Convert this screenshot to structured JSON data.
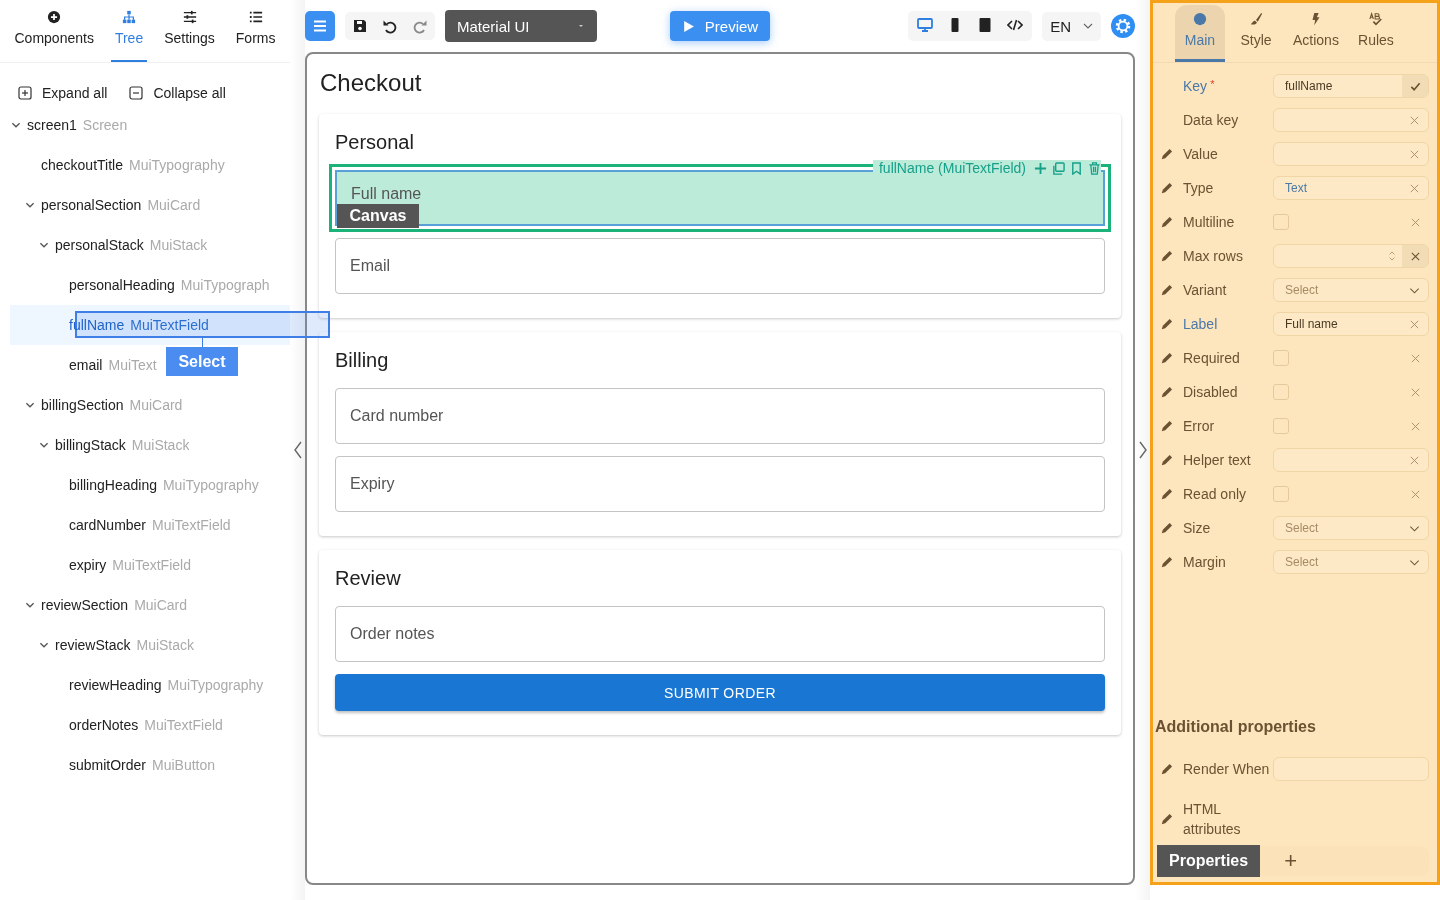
{
  "left_tabs": [
    {
      "label": "Components",
      "selected": false
    },
    {
      "label": "Tree",
      "selected": true
    },
    {
      "label": "Settings",
      "selected": false
    },
    {
      "label": "Forms",
      "selected": false
    }
  ],
  "tree_actions": [
    "Expand all",
    "Collapse all"
  ],
  "tree": [
    {
      "name": "screen1",
      "type": "Screen",
      "expanded": true,
      "selected": false,
      "children": [
        {
          "name": "checkoutTitle",
          "type": "MuiTypography",
          "selected": false
        },
        {
          "name": "personalSection",
          "type": "MuiCard",
          "expanded": true,
          "selected": false,
          "children": [
            {
              "name": "personalStack",
              "type": "MuiStack",
              "expanded": true,
              "selected": false,
              "children": [
                {
                  "name": "personalHeading",
                  "type": "MuiTypograph",
                  "selected": false
                },
                {
                  "name": "fullName",
                  "type": "MuiTextField",
                  "selected": true
                },
                {
                  "name": "email",
                  "type": "MuiText",
                  "selected": false
                }
              ]
            }
          ]
        },
        {
          "name": "billingSection",
          "type": "MuiCard",
          "expanded": true,
          "selected": false,
          "children": [
            {
              "name": "billingStack",
              "type": "MuiStack",
              "expanded": true,
              "selected": false,
              "children": [
                {
                  "name": "billingHeading",
                  "type": "MuiTypography",
                  "selected": false
                },
                {
                  "name": "cardNumber",
                  "type": "MuiTextField",
                  "selected": false
                },
                {
                  "name": "expiry",
                  "type": "MuiTextField",
                  "selected": false
                }
              ]
            }
          ]
        },
        {
          "name": "reviewSection",
          "type": "MuiCard",
          "expanded": true,
          "selected": false,
          "children": [
            {
              "name": "reviewStack",
              "type": "MuiStack",
              "expanded": true,
              "selected": false,
              "children": [
                {
                  "name": "reviewHeading",
                  "type": "MuiTypography",
                  "selected": false
                },
                {
                  "name": "orderNotes",
                  "type": "MuiTextField",
                  "selected": false
                },
                {
                  "name": "submitOrder",
                  "type": "MuiButton",
                  "selected": false
                }
              ]
            }
          ]
        }
      ]
    }
  ],
  "tree_drop_label": "Select",
  "toolbar": {
    "framework": "Material UI",
    "preview": "Preview",
    "language": "EN",
    "devices": [
      {
        "selected": true
      },
      {
        "selected": false
      },
      {
        "selected": false
      },
      {
        "selected": false
      }
    ]
  },
  "canvas": {
    "title": "Checkout",
    "drop_label": "Canvas",
    "sections": [
      {
        "heading": "Personal",
        "fields": [
          {
            "label": "Full name",
            "selected": true,
            "caption": "fullName (MuiTextField)"
          },
          {
            "label": "Email",
            "selected": false
          }
        ]
      },
      {
        "heading": "Billing",
        "fields": [
          {
            "label": "Card number",
            "selected": false
          },
          {
            "label": "Expiry",
            "selected": false
          }
        ]
      },
      {
        "heading": "Review",
        "fields": [
          {
            "label": "Order notes",
            "selected": false
          }
        ],
        "button": "SUBMIT ORDER"
      }
    ]
  },
  "right_tabs": [
    {
      "label": "Main",
      "selected": true
    },
    {
      "label": "Style",
      "selected": false
    },
    {
      "label": "Actions",
      "selected": false
    },
    {
      "label": "Rules",
      "selected": false
    }
  ],
  "props": [
    {
      "kind": "text",
      "label": "Key",
      "required_mark": "*",
      "highlighted": true,
      "editable": false,
      "value": "fullName",
      "confirm": true
    },
    {
      "kind": "text",
      "label": "Data key",
      "highlighted": false,
      "editable": false
    },
    {
      "kind": "text",
      "label": "Value",
      "highlighted": false,
      "editable": true
    },
    {
      "kind": "text",
      "label": "Type",
      "highlighted": false,
      "editable": true,
      "value": "Text",
      "value_default": true
    },
    {
      "kind": "checkbox",
      "label": "Multiline",
      "highlighted": false,
      "editable": true,
      "checked": false
    },
    {
      "kind": "number",
      "label": "Max rows",
      "highlighted": false,
      "editable": true
    },
    {
      "kind": "select",
      "label": "Variant",
      "highlighted": false,
      "editable": true,
      "placeholder": "Select"
    },
    {
      "kind": "text",
      "label": "Label",
      "highlighted": true,
      "editable": true,
      "value": "Full name"
    },
    {
      "kind": "checkbox",
      "label": "Required",
      "highlighted": false,
      "editable": true,
      "checked": false
    },
    {
      "kind": "checkbox",
      "label": "Disabled",
      "highlighted": false,
      "editable": true,
      "checked": false
    },
    {
      "kind": "checkbox",
      "label": "Error",
      "highlighted": false,
      "editable": true,
      "checked": false
    },
    {
      "kind": "text",
      "label": "Helper text",
      "highlighted": false,
      "editable": true
    },
    {
      "kind": "checkbox",
      "label": "Read only",
      "highlighted": false,
      "editable": true,
      "checked": false
    },
    {
      "kind": "select",
      "label": "Size",
      "highlighted": false,
      "editable": true,
      "placeholder": "Select"
    },
    {
      "kind": "select",
      "label": "Margin",
      "highlighted": false,
      "editable": true,
      "placeholder": "Select"
    }
  ],
  "additional": {
    "heading": "Additional properties",
    "rows": [
      {
        "kind": "input",
        "label": "Render When"
      },
      {
        "kind": "none",
        "label": "HTML attributes"
      }
    ]
  },
  "properties_drop_label": "Properties",
  "add_button": "+"
}
